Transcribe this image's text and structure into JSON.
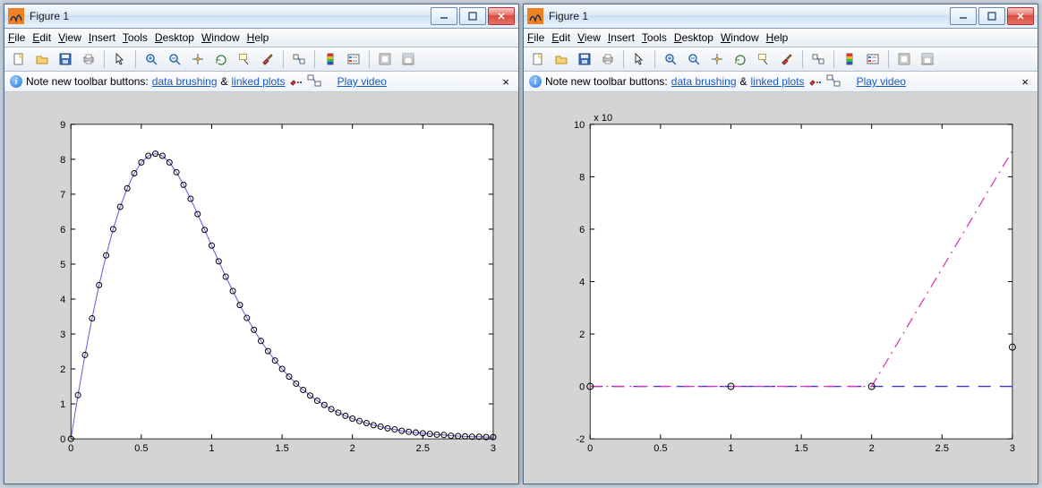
{
  "windows": [
    {
      "title": "Figure 1"
    },
    {
      "title": "Figure 1"
    }
  ],
  "menus": [
    "File",
    "Edit",
    "View",
    "Insert",
    "Tools",
    "Desktop",
    "Window",
    "Help"
  ],
  "info": {
    "prefix": "Note new toolbar buttons:",
    "link1": "data brushing",
    "amp": "&",
    "link2": "linked plots",
    "play": "Play video"
  },
  "toolbar_icons": [
    "new-doc-icon",
    "open-folder-icon",
    "save-icon",
    "print-icon",
    "sep",
    "pointer-icon",
    "sep",
    "zoom-in-icon",
    "zoom-out-icon",
    "pan-icon",
    "rotate-icon",
    "data-cursor-icon",
    "brush-icon",
    "sep",
    "link-plots-icon",
    "sep",
    "colorbar-icon",
    "legend-icon",
    "sep",
    "hide-tools-icon",
    "show-tools-icon"
  ],
  "chart_data": [
    {
      "type": "line",
      "window": 0,
      "xlabel": "",
      "ylabel": "",
      "xlim": [
        0,
        3
      ],
      "ylim": [
        0,
        9
      ],
      "xticks": [
        0,
        0.5,
        1,
        1.5,
        2,
        2.5,
        3
      ],
      "yticks": [
        0,
        1,
        2,
        3,
        4,
        5,
        6,
        7,
        8,
        9
      ],
      "x_markers": [
        0.0,
        0.05,
        0.1,
        0.15,
        0.2,
        0.25,
        0.3,
        0.35,
        0.4,
        0.45,
        0.5,
        0.55,
        0.6,
        0.65,
        0.7,
        0.75,
        0.8,
        0.85,
        0.9,
        0.95,
        1.0,
        1.05,
        1.1,
        1.15,
        1.2,
        1.25,
        1.3,
        1.35,
        1.4,
        1.45,
        1.5,
        1.55,
        1.6,
        1.65,
        1.7,
        1.75,
        1.8,
        1.85,
        1.9,
        1.95,
        2.0,
        2.05,
        2.1,
        2.15,
        2.2,
        2.25,
        2.3,
        2.35,
        2.4,
        2.45,
        2.5,
        2.55,
        2.6,
        2.65,
        2.7,
        2.75,
        2.8,
        2.85,
        2.9,
        2.95,
        3.0
      ],
      "y_markers": [
        0.0,
        1.25,
        2.4,
        3.45,
        4.4,
        5.25,
        6.0,
        6.64,
        7.17,
        7.6,
        7.91,
        8.1,
        8.16,
        8.1,
        7.91,
        7.63,
        7.27,
        6.87,
        6.43,
        5.98,
        5.53,
        5.08,
        4.64,
        4.23,
        3.83,
        3.46,
        3.12,
        2.8,
        2.51,
        2.24,
        2.0,
        1.78,
        1.58,
        1.4,
        1.24,
        1.09,
        0.97,
        0.85,
        0.75,
        0.66,
        0.58,
        0.51,
        0.45,
        0.39,
        0.35,
        0.3,
        0.27,
        0.23,
        0.2,
        0.18,
        0.16,
        0.14,
        0.12,
        0.11,
        0.09,
        0.08,
        0.07,
        0.06,
        0.06,
        0.05,
        0.05
      ]
    },
    {
      "type": "line",
      "window": 1,
      "y_exponent_label": "x 10",
      "xlabel": "",
      "ylabel": "",
      "xlim": [
        0,
        3
      ],
      "ylim": [
        -2,
        10
      ],
      "xticks": [
        0,
        0.5,
        1,
        1.5,
        2,
        2.5,
        3
      ],
      "yticks": [
        -2,
        0,
        2,
        4,
        6,
        8,
        10
      ],
      "series": [
        {
          "name": "dashed-blue",
          "style": "dashed",
          "color": "#3a3abf",
          "x": [
            0,
            1,
            2,
            3
          ],
          "y": [
            0,
            0,
            0,
            0
          ]
        },
        {
          "name": "dashdot-magenta",
          "style": "dashdot",
          "color": "#d63ab8",
          "x": [
            0,
            1,
            2,
            3
          ],
          "y": [
            0,
            0,
            0,
            9
          ]
        },
        {
          "name": "markers",
          "style": "marker",
          "color": "#000",
          "x": [
            0,
            1,
            2,
            3
          ],
          "y": [
            0,
            0,
            0,
            1.5
          ]
        }
      ]
    }
  ]
}
